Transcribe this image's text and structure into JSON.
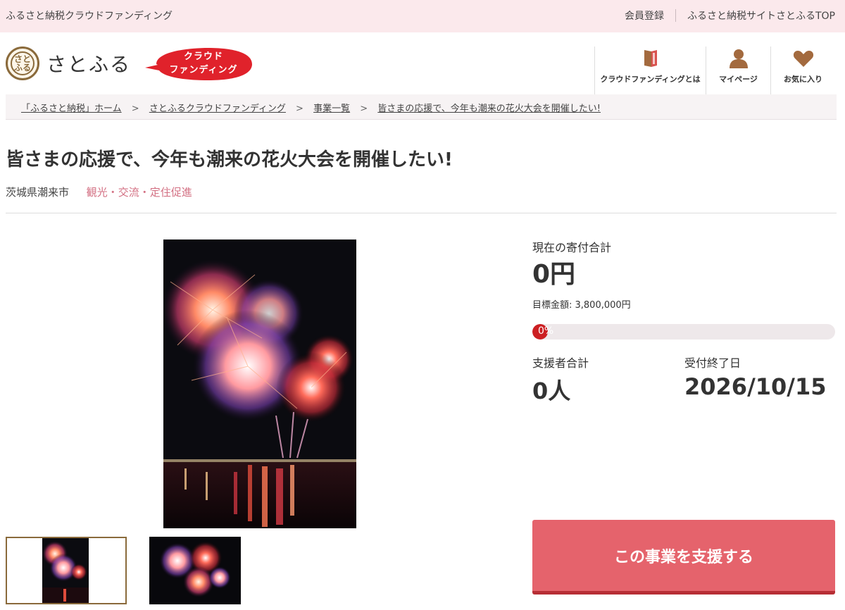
{
  "topbar": {
    "site_name": "ふるさと納税クラウドファンディング",
    "member_register": "会員登録",
    "satofull_top": "ふるさと納税サイトさとふるTOP"
  },
  "header": {
    "logo_text": "さとふる",
    "logo_mark_text": "さとふる",
    "cf_badge_line1": "クラウド",
    "cf_badge_line2": "ファンディング",
    "cf_badge_color": "#e0222b",
    "nav": [
      {
        "label": "クラウドファンディングとは",
        "icon": "book-icon"
      },
      {
        "label": "マイページ",
        "icon": "user-icon"
      },
      {
        "label": "お気に入り",
        "icon": "heart-icon"
      }
    ],
    "nav_icon_color": "#a36a3e"
  },
  "breadcrumb": [
    "「ふるさと納税」ホーム",
    "さとふるクラウドファンディング",
    "事業一覧",
    "皆さまの応援で、今年も潮来の花火大会を開催したい!"
  ],
  "breadcrumb_sep": ">",
  "project": {
    "title": "皆さまの応援で、今年も潮来の花火大会を開催したい!",
    "location": "茨城県潮来市",
    "category": "観光・交流・定住促進"
  },
  "stats": {
    "current_label": "現在の寄付合計",
    "current_value": "0円",
    "goal_text": "目標金額: 3,800,000円",
    "progress_text": "0%",
    "progress_fraction": 0,
    "supporters_label": "支援者合計",
    "supporters_value": "0人",
    "deadline_label": "受付終了日",
    "deadline_value": "2026/10/15"
  },
  "cta": {
    "support_button": "この事業を支援する",
    "button_color": "#e5636c"
  }
}
